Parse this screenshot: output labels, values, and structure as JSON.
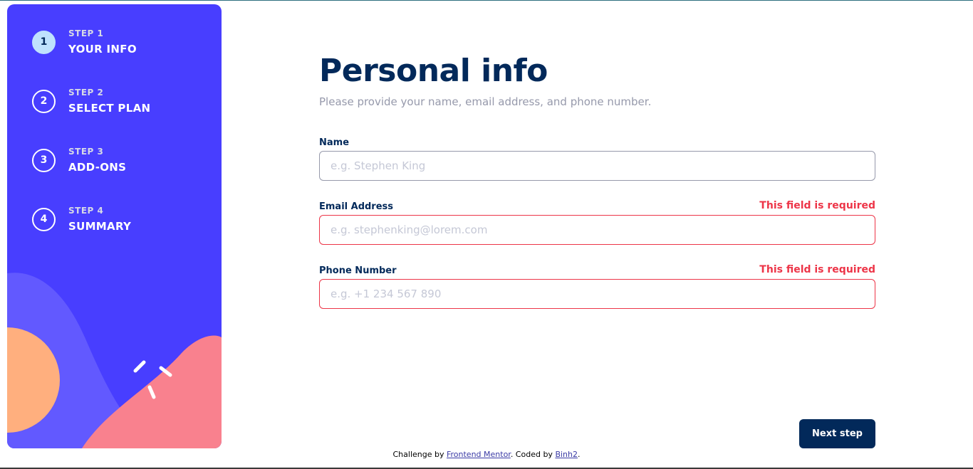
{
  "colors": {
    "sidebar_bg": "#483eff",
    "active_step": "#bfe2fd",
    "title": "#02295a",
    "error": "#ed3548",
    "button_bg": "#02295a"
  },
  "sidebar": {
    "steps": [
      {
        "number": "1",
        "label": "STEP 1",
        "name": "YOUR INFO",
        "active": true
      },
      {
        "number": "2",
        "label": "STEP 2",
        "name": "SELECT PLAN",
        "active": false
      },
      {
        "number": "3",
        "label": "STEP 3",
        "name": "ADD-ONS",
        "active": false
      },
      {
        "number": "4",
        "label": "STEP 4",
        "name": "SUMMARY",
        "active": false
      }
    ]
  },
  "form": {
    "title": "Personal info",
    "subtitle": "Please provide your name, email address, and phone number.",
    "fields": [
      {
        "label": "Name",
        "placeholder": "e.g. Stephen King",
        "value": "",
        "error": ""
      },
      {
        "label": "Email Address",
        "placeholder": "e.g. stephenking@lorem.com",
        "value": "",
        "error": "This field is required"
      },
      {
        "label": "Phone Number",
        "placeholder": "e.g. +1 234 567 890",
        "value": "",
        "error": "This field is required"
      }
    ],
    "next_label": "Next step"
  },
  "attribution": {
    "prefix": "Challenge by",
    "link1": "Frontend Mentor",
    "middle": ". Coded by",
    "link2": "Binh2",
    "suffix": "."
  }
}
